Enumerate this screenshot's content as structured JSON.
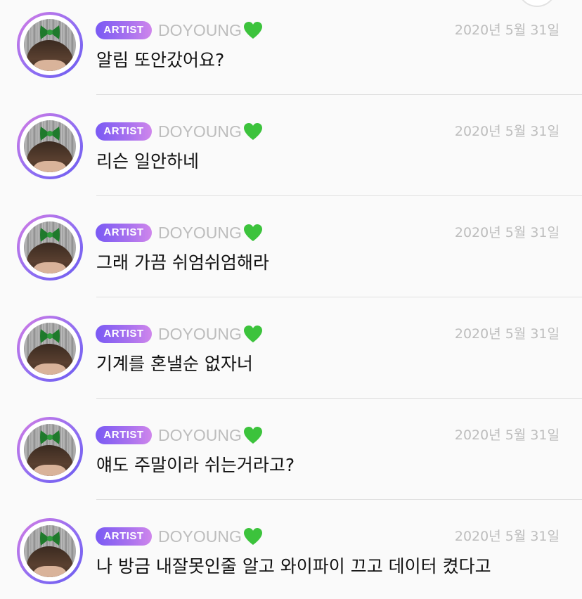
{
  "colors": {
    "background": "#fafafa",
    "badge_gradient_start": "#7a5af4",
    "badge_gradient_end": "#cf86ec",
    "heart": "#3cc33c",
    "muted_text": "#bdbdbd",
    "message_text": "#111111"
  },
  "messages": [
    {
      "badge": "ARTIST",
      "name": "DOYOUNG",
      "icon": "green-heart-icon",
      "date": "2020년 5월 31일",
      "text": "알림 또안갔어요?"
    },
    {
      "badge": "ARTIST",
      "name": "DOYOUNG",
      "icon": "green-heart-icon",
      "date": "2020년 5월 31일",
      "text": "리슨 일안하네"
    },
    {
      "badge": "ARTIST",
      "name": "DOYOUNG",
      "icon": "green-heart-icon",
      "date": "2020년 5월 31일",
      "text": "그래 가끔 쉬엄쉬엄해라"
    },
    {
      "badge": "ARTIST",
      "name": "DOYOUNG",
      "icon": "green-heart-icon",
      "date": "2020년 5월 31일",
      "text": "기계를 혼낼순 없자너"
    },
    {
      "badge": "ARTIST",
      "name": "DOYOUNG",
      "icon": "green-heart-icon",
      "date": "2020년 5월 31일",
      "text": "얘도 주말이라 쉬는거라고?"
    },
    {
      "badge": "ARTIST",
      "name": "DOYOUNG",
      "icon": "green-heart-icon",
      "date": "2020년 5월 31일",
      "text": "나 방금 내잘못인줄 알고 와이파이 끄고 데이터 켰다고"
    }
  ]
}
